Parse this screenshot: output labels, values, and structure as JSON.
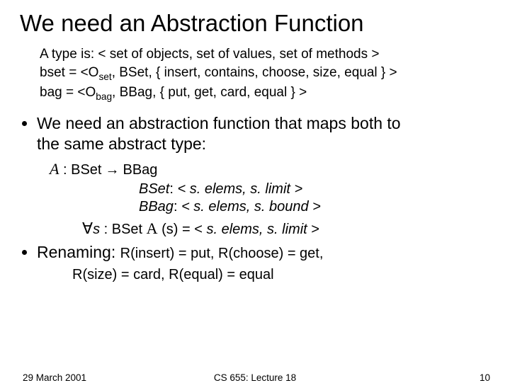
{
  "title": "We need an Abstraction Function",
  "typeblock": {
    "line1_pre": "A type is:   < set of objects, set of values, set of methods >",
    "line2_pre": "bset = <O",
    "line2_sub": "set",
    "line2_post": ", BSet, { insert, contains, choose, size, equal } >",
    "line3_pre": "bag = <O",
    "line3_sub": "bag",
    "line3_post": ", BBag, { put, get, card, equal } >"
  },
  "bullet1a": "We need an abstraction function that maps both to",
  "bullet1b": "the same abstract type:",
  "afun": {
    "A": "A",
    "rest": " : BSet",
    "arrow": " → ",
    "rhs": "BBag"
  },
  "def1": {
    "lhs": "BSet",
    "colon": ": ",
    "body": "< s. elems, s. limit >"
  },
  "def2": {
    "lhs": "BBag",
    "colon": ": ",
    "body": "< s. elems, s. bound >"
  },
  "forall": {
    "sym": "∀",
    "s": "s",
    "colon": " : ",
    "bset": "BSet",
    "A": "A",
    "paren": " (s) = < ",
    "body": "s. elems, s. limit",
    "close": " >"
  },
  "bullet2_lead": "Renaming:  ",
  "bullet2_rest": "R(insert) = put, R(choose) = get,",
  "rename_cont": "R(size) = card, R(equal) = equal",
  "footer": {
    "date": "29 March 2001",
    "course": "CS 655: Lecture 18",
    "page": "10"
  }
}
